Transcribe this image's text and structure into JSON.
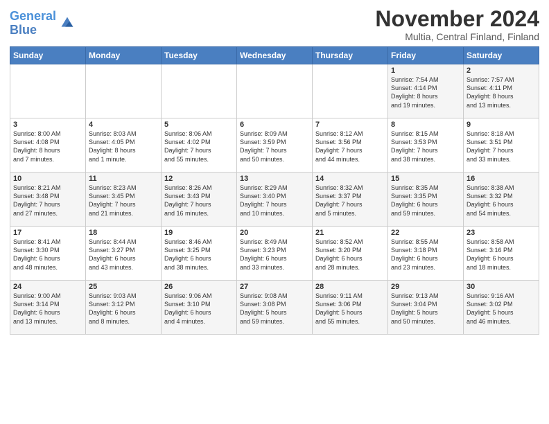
{
  "header": {
    "logo_line1": "General",
    "logo_line2": "Blue",
    "title": "November 2024",
    "subtitle": "Multia, Central Finland, Finland"
  },
  "days_of_week": [
    "Sunday",
    "Monday",
    "Tuesday",
    "Wednesday",
    "Thursday",
    "Friday",
    "Saturday"
  ],
  "weeks": [
    [
      {
        "day": "",
        "info": ""
      },
      {
        "day": "",
        "info": ""
      },
      {
        "day": "",
        "info": ""
      },
      {
        "day": "",
        "info": ""
      },
      {
        "day": "",
        "info": ""
      },
      {
        "day": "1",
        "info": "Sunrise: 7:54 AM\nSunset: 4:14 PM\nDaylight: 8 hours\nand 19 minutes."
      },
      {
        "day": "2",
        "info": "Sunrise: 7:57 AM\nSunset: 4:11 PM\nDaylight: 8 hours\nand 13 minutes."
      }
    ],
    [
      {
        "day": "3",
        "info": "Sunrise: 8:00 AM\nSunset: 4:08 PM\nDaylight: 8 hours\nand 7 minutes."
      },
      {
        "day": "4",
        "info": "Sunrise: 8:03 AM\nSunset: 4:05 PM\nDaylight: 8 hours\nand 1 minute."
      },
      {
        "day": "5",
        "info": "Sunrise: 8:06 AM\nSunset: 4:02 PM\nDaylight: 7 hours\nand 55 minutes."
      },
      {
        "day": "6",
        "info": "Sunrise: 8:09 AM\nSunset: 3:59 PM\nDaylight: 7 hours\nand 50 minutes."
      },
      {
        "day": "7",
        "info": "Sunrise: 8:12 AM\nSunset: 3:56 PM\nDaylight: 7 hours\nand 44 minutes."
      },
      {
        "day": "8",
        "info": "Sunrise: 8:15 AM\nSunset: 3:53 PM\nDaylight: 7 hours\nand 38 minutes."
      },
      {
        "day": "9",
        "info": "Sunrise: 8:18 AM\nSunset: 3:51 PM\nDaylight: 7 hours\nand 33 minutes."
      }
    ],
    [
      {
        "day": "10",
        "info": "Sunrise: 8:21 AM\nSunset: 3:48 PM\nDaylight: 7 hours\nand 27 minutes."
      },
      {
        "day": "11",
        "info": "Sunrise: 8:23 AM\nSunset: 3:45 PM\nDaylight: 7 hours\nand 21 minutes."
      },
      {
        "day": "12",
        "info": "Sunrise: 8:26 AM\nSunset: 3:43 PM\nDaylight: 7 hours\nand 16 minutes."
      },
      {
        "day": "13",
        "info": "Sunrise: 8:29 AM\nSunset: 3:40 PM\nDaylight: 7 hours\nand 10 minutes."
      },
      {
        "day": "14",
        "info": "Sunrise: 8:32 AM\nSunset: 3:37 PM\nDaylight: 7 hours\nand 5 minutes."
      },
      {
        "day": "15",
        "info": "Sunrise: 8:35 AM\nSunset: 3:35 PM\nDaylight: 6 hours\nand 59 minutes."
      },
      {
        "day": "16",
        "info": "Sunrise: 8:38 AM\nSunset: 3:32 PM\nDaylight: 6 hours\nand 54 minutes."
      }
    ],
    [
      {
        "day": "17",
        "info": "Sunrise: 8:41 AM\nSunset: 3:30 PM\nDaylight: 6 hours\nand 48 minutes."
      },
      {
        "day": "18",
        "info": "Sunrise: 8:44 AM\nSunset: 3:27 PM\nDaylight: 6 hours\nand 43 minutes."
      },
      {
        "day": "19",
        "info": "Sunrise: 8:46 AM\nSunset: 3:25 PM\nDaylight: 6 hours\nand 38 minutes."
      },
      {
        "day": "20",
        "info": "Sunrise: 8:49 AM\nSunset: 3:23 PM\nDaylight: 6 hours\nand 33 minutes."
      },
      {
        "day": "21",
        "info": "Sunrise: 8:52 AM\nSunset: 3:20 PM\nDaylight: 6 hours\nand 28 minutes."
      },
      {
        "day": "22",
        "info": "Sunrise: 8:55 AM\nSunset: 3:18 PM\nDaylight: 6 hours\nand 23 minutes."
      },
      {
        "day": "23",
        "info": "Sunrise: 8:58 AM\nSunset: 3:16 PM\nDaylight: 6 hours\nand 18 minutes."
      }
    ],
    [
      {
        "day": "24",
        "info": "Sunrise: 9:00 AM\nSunset: 3:14 PM\nDaylight: 6 hours\nand 13 minutes."
      },
      {
        "day": "25",
        "info": "Sunrise: 9:03 AM\nSunset: 3:12 PM\nDaylight: 6 hours\nand 8 minutes."
      },
      {
        "day": "26",
        "info": "Sunrise: 9:06 AM\nSunset: 3:10 PM\nDaylight: 6 hours\nand 4 minutes."
      },
      {
        "day": "27",
        "info": "Sunrise: 9:08 AM\nSunset: 3:08 PM\nDaylight: 5 hours\nand 59 minutes."
      },
      {
        "day": "28",
        "info": "Sunrise: 9:11 AM\nSunset: 3:06 PM\nDaylight: 5 hours\nand 55 minutes."
      },
      {
        "day": "29",
        "info": "Sunrise: 9:13 AM\nSunset: 3:04 PM\nDaylight: 5 hours\nand 50 minutes."
      },
      {
        "day": "30",
        "info": "Sunrise: 9:16 AM\nSunset: 3:02 PM\nDaylight: 5 hours\nand 46 minutes."
      }
    ]
  ]
}
